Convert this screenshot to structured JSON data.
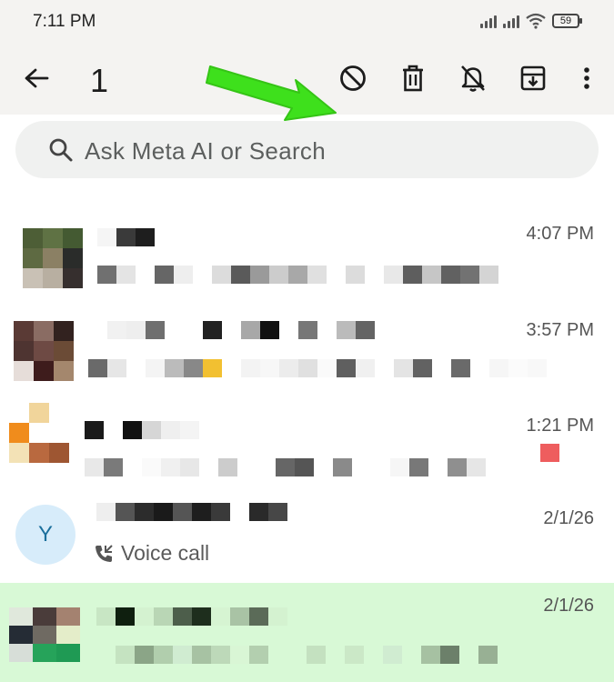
{
  "status_bar": {
    "time": "7:11 PM",
    "battery": "59"
  },
  "action_bar": {
    "selected_count": "1",
    "actions": [
      "block-icon",
      "delete-icon",
      "mute-icon",
      "archive-icon",
      "more-icon"
    ]
  },
  "search": {
    "placeholder": "Ask Meta AI or Search"
  },
  "chats": [
    {
      "time": "4:07 PM"
    },
    {
      "time": "3:57 PM"
    },
    {
      "time": "1:21 PM"
    },
    {
      "avatar_letter": "Y",
      "time": "2/1/26",
      "preview": "Voice call"
    },
    {
      "time": "2/1/26",
      "selected": true
    }
  ],
  "colors": {
    "accent_arrow": "#3ee01c",
    "selected_row": "#d8f9d6",
    "avatar_bg": "#d7ecfa"
  }
}
